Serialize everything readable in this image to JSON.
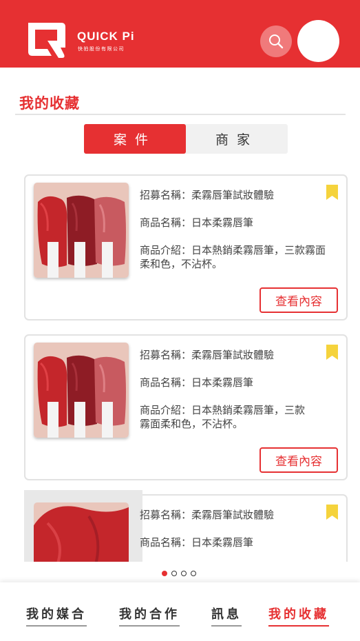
{
  "header": {
    "logo_text": "QUICK Pi",
    "logo_subtitle": "快拍股份有限公司",
    "search_icon": "search-icon",
    "avatar_icon": "avatar"
  },
  "page": {
    "title": "我的收藏"
  },
  "tabs": [
    {
      "label": "案件",
      "active": true
    },
    {
      "label": "商家",
      "active": false
    }
  ],
  "cards": [
    {
      "recruit": "招募名稱：柔霧唇筆試妝體驗",
      "product": "商品名稱：日本柔霧唇筆",
      "intro_1": "商品介紹：日本熱銷柔霧唇筆，三款霧面",
      "intro_2": "柔和色，不沾杯。",
      "button": "查看內容",
      "bookmarked": true
    },
    {
      "recruit": "招募名稱：柔霧唇筆試妝體驗",
      "product": "商品名稱：日本柔霧唇筆",
      "intro_1": "商品介紹：日本熱銷柔霧唇筆，三款",
      "intro_2": "霧面柔和色，不沾杯。",
      "button": "查看內容",
      "bookmarked": true
    },
    {
      "recruit": "招募名稱：柔霧唇筆試妝體驗",
      "product": "商品名稱：日本柔霧唇筆",
      "bookmarked": true
    }
  ],
  "pagination": {
    "total": 4,
    "current": 1
  },
  "bottom_nav": [
    {
      "label": "我的媒合",
      "active": false
    },
    {
      "label": "我的合作",
      "active": false
    },
    {
      "label": "訊息",
      "active": false
    },
    {
      "label": "我的收藏",
      "active": true
    }
  ],
  "colors": {
    "brand": "#e63032",
    "bookmark": "#f5d33c"
  }
}
